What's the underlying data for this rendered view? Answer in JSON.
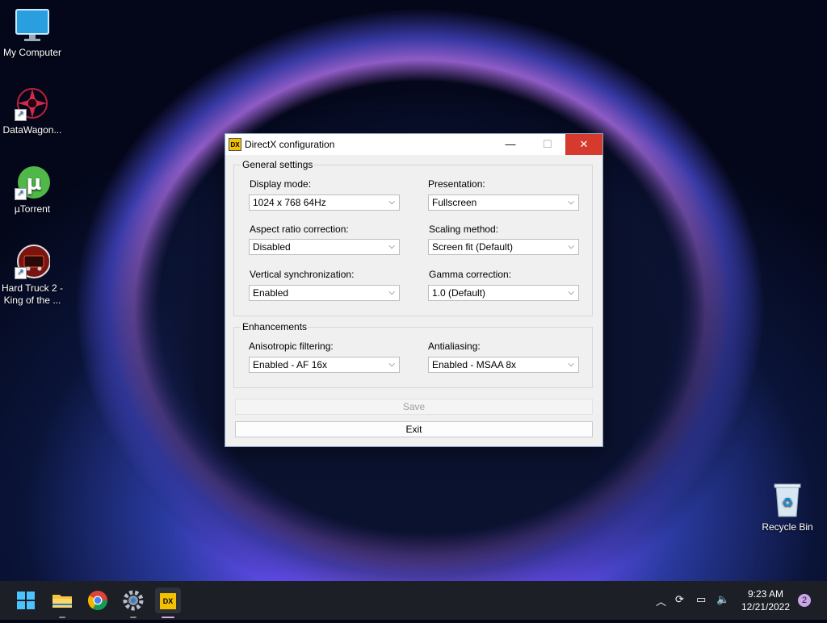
{
  "desktop": {
    "icons": [
      {
        "label": "My Computer"
      },
      {
        "label": "DataWagon..."
      },
      {
        "label": "µTorrent"
      },
      {
        "label": "Hard Truck 2 - King of the ..."
      },
      {
        "label": "Recycle Bin"
      }
    ]
  },
  "window": {
    "title": "DirectX configuration",
    "icon_text": "DX",
    "controls": {
      "minimize": "—",
      "maximize": "☐",
      "close": "✕"
    },
    "general": {
      "title": "General settings",
      "display_mode": {
        "label": "Display mode:",
        "value": "1024 x 768  64Hz"
      },
      "presentation": {
        "label": "Presentation:",
        "value": "Fullscreen"
      },
      "aspect_ratio": {
        "label": "Aspect ratio correction:",
        "value": "Disabled"
      },
      "scaling": {
        "label": "Scaling method:",
        "value": "Screen fit (Default)"
      },
      "vsync": {
        "label": "Vertical synchronization:",
        "value": "Enabled"
      },
      "gamma": {
        "label": "Gamma correction:",
        "value": "1.0 (Default)"
      }
    },
    "enhancements": {
      "title": "Enhancements",
      "anisotropic": {
        "label": "Anisotropic filtering:",
        "value": "Enabled - AF 16x"
      },
      "antialiasing": {
        "label": "Antialiasing:",
        "value": "Enabled - MSAA 8x"
      }
    },
    "save_label": "Save",
    "exit_label": "Exit"
  },
  "taskbar": {
    "clock_time": "9:23 AM",
    "clock_date": "12/21/2022",
    "notification_count": "2",
    "dx_icon_text": "DX"
  },
  "colors": {
    "close_button": "#d63a2e",
    "accent": "#1a6fd8"
  }
}
